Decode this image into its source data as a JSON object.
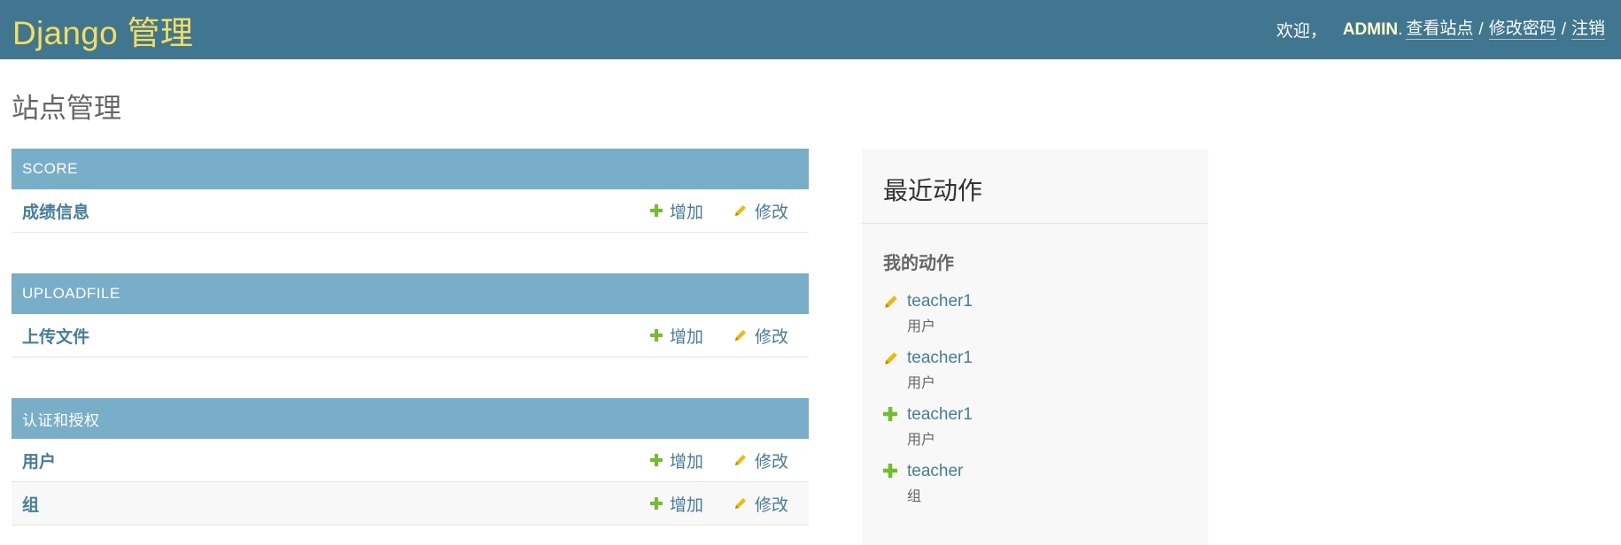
{
  "header": {
    "branding": "Django 管理",
    "welcome": "欢迎，",
    "username": "ADMIN",
    "period": ".",
    "view_site": "查看站点",
    "change_password": "修改密码",
    "logout": "注销",
    "separator": "/"
  },
  "page_title": "站点管理",
  "modules": [
    {
      "caption": "SCORE",
      "models": [
        {
          "name": "成绩信息",
          "add_label": "增加",
          "change_label": "修改"
        }
      ]
    },
    {
      "caption": "UPLOADFILE",
      "models": [
        {
          "name": "上传文件",
          "add_label": "增加",
          "change_label": "修改"
        }
      ]
    },
    {
      "caption": "认证和授权",
      "models": [
        {
          "name": "用户",
          "add_label": "增加",
          "change_label": "修改"
        },
        {
          "name": "组",
          "add_label": "增加",
          "change_label": "修改"
        }
      ]
    }
  ],
  "recent_actions": {
    "title": "最近动作",
    "subtitle": "我的动作",
    "items": [
      {
        "icon": "pencil-icon",
        "name": "teacher1",
        "type": "用户"
      },
      {
        "icon": "pencil-icon",
        "name": "teacher1",
        "type": "用户"
      },
      {
        "icon": "plus-icon",
        "name": "teacher1",
        "type": "用户"
      },
      {
        "icon": "plus-icon",
        "name": "teacher",
        "type": "组"
      }
    ]
  },
  "colors": {
    "header_bg": "#417690",
    "branding": "#f5dd5d",
    "caption_bg": "#79aec8",
    "link": "#447e9b",
    "add_icon": "#70bf2b",
    "change_icon": "#efb80b"
  }
}
